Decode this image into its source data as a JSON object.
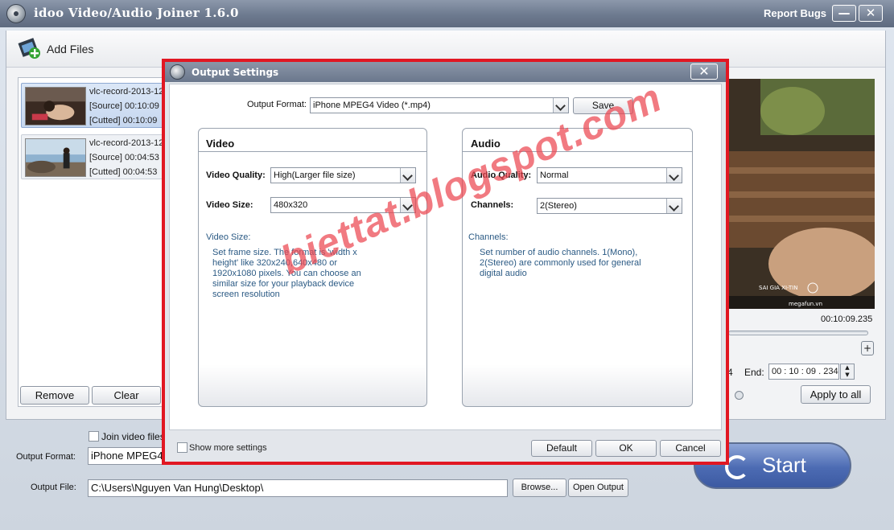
{
  "window": {
    "title": "idoo Video/Audio Joiner 1.6.0",
    "report_bugs": "Report Bugs",
    "minimize": "—",
    "close": "✕"
  },
  "toolbar": {
    "add_files": "Add Files"
  },
  "file_list": {
    "items": [
      {
        "name": "vlc-record-2013-12",
        "source": "[Source]  00:10:09",
        "cutted": "[Cutted]  00:10:09",
        "selected": true
      },
      {
        "name": "vlc-record-2013-12",
        "source": "[Source]  00:04:53",
        "cutted": "[Cutted]  00:04:53",
        "selected": false
      }
    ],
    "remove_label": "Remove",
    "clear_label": "Clear"
  },
  "preview": {
    "time": "00:10:09.235",
    "end_prefix": "4",
    "end_label": "End:",
    "end_value": "00 : 10 : 09 . 234",
    "apply_all": "Apply to all",
    "zoom_icon": "+",
    "overlay_text": "SAI GIA XI-TIN",
    "overlay_site": "megafun.vn"
  },
  "bottom": {
    "join_label": "Join video files o",
    "output_format_label": "Output Format:",
    "output_format_value": "iPhone MPEG4",
    "output_file_label": "Output File:",
    "output_file_value": "C:\\Users\\Nguyen Van Hung\\Desktop\\",
    "browse": "Browse...",
    "open_output": "Open Output",
    "start": "Start"
  },
  "dialog": {
    "title": "Output Settings",
    "close": "✕",
    "output_format_label": "Output Format:",
    "output_format_value": "iPhone MPEG4 Video (*.mp4)",
    "save": "Save",
    "video": {
      "title": "Video",
      "quality_label": "Video Quality:",
      "quality_value": "High(Larger file size)",
      "size_label": "Video Size:",
      "size_value": "480x320",
      "help_head": "Video Size:",
      "help_lines": [
        "Set frame size. The format is 'width x",
        "height' like 320x240,640x480 or",
        "1920x1080 pixels. You can choose an",
        "similar size for your playback device",
        "screen resolution"
      ]
    },
    "audio": {
      "title": "Audio",
      "quality_label": "Audio Quality:",
      "quality_value": "Normal",
      "channels_label": "Channels:",
      "channels_value": "2(Stereo)",
      "help_head": "Channels:",
      "help_lines": [
        "Set number of audio channels. 1(Mono),",
        "2(Stereo) are commonly used for general",
        "digital audio"
      ]
    },
    "show_more": "Show more settings",
    "default": "Default",
    "ok": "OK",
    "cancel": "Cancel"
  },
  "watermark": "biettat.blogspot.com",
  "colors": {
    "highlight_frame": "#e11722",
    "title_bar": "#6d7a8f",
    "start_button": "#4c6bb3",
    "help_text": "#2b5a84"
  }
}
